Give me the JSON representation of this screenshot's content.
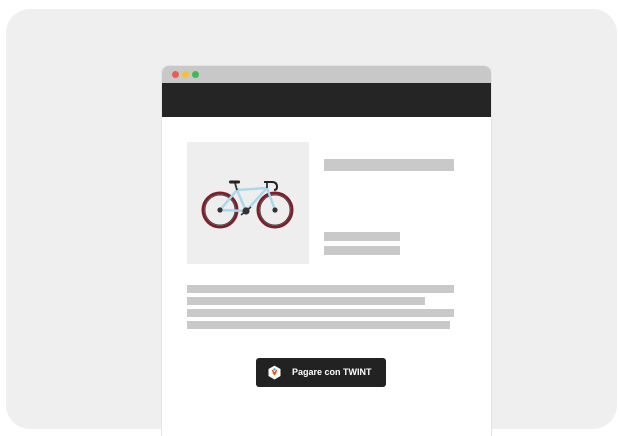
{
  "payment": {
    "button_label": "Pagare con TWINT"
  },
  "colors": {
    "background_card": "#efefef",
    "browser_titlebar": "#c8c8c8",
    "browser_navbar": "#252525",
    "window_close": "#ee5a5a",
    "window_minimize": "#f4c136",
    "window_maximize": "#3fb950",
    "placeholder_text": "#c9c9c9",
    "bike_frame": "#a8d8ea",
    "bike_tire": "#7a1f2b",
    "button_background": "#222222"
  },
  "icons": {
    "product": "bicycle-icon",
    "payment": "twint-logo-icon"
  }
}
